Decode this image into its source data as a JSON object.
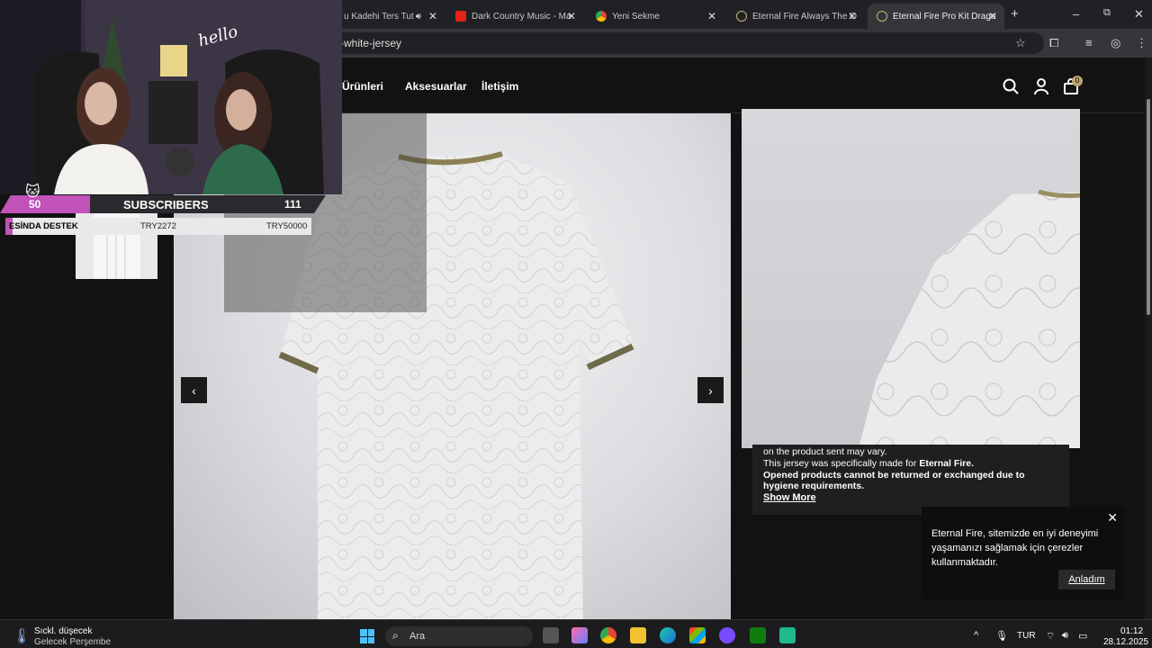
{
  "browser": {
    "tabs": [
      {
        "label": "u Kadehi Ters Tut",
        "icon": "audio-icon"
      },
      {
        "label": "Dark Country Music - Ma",
        "icon": "youtube-icon"
      },
      {
        "label": "Yeni Sekme",
        "icon": "chrome-icon"
      },
      {
        "label": "Eternal Fire Always The O",
        "icon": "eternal-fire-icon"
      },
      {
        "label": "Eternal Fire Pro Kit Drago",
        "icon": "eternal-fire-icon",
        "active": true
      }
    ],
    "new_tab": "+",
    "url": "-white-jersey",
    "window_controls": {
      "minimize": "–",
      "maximize": "⧉",
      "close": "✕"
    }
  },
  "site": {
    "nav": [
      "r Ürünleri",
      "Aksesuarlar",
      "İletişim"
    ],
    "cart_count": "0"
  },
  "gallery": {
    "prev": "‹",
    "next": "›"
  },
  "description": {
    "line1": "on the product sent may vary.",
    "line2_pre": "This jersey was specifically made for ",
    "line2_bold": "Eternal Fire.",
    "line3": "Opened products cannot be returned or exchanged due to",
    "line4": "hygiene requirements.",
    "show_more": "Show More"
  },
  "cookie": {
    "text": "Eternal Fire, sitemizde en iyi deneyimi yaşamanızı sağlamak için çerezler kullanmaktadır.",
    "button": "Anladım",
    "close": "✕"
  },
  "stream_overlay": {
    "hello": "hello",
    "subs_left": "50",
    "subs_label": "SUBSCRIBERS",
    "subs_right": "111",
    "donation_label": "ESİNDA DESTEK",
    "donation_current": "TRY2272",
    "donation_goal": "TRY50000",
    "accent_color": "#c052b8"
  },
  "taskbar": {
    "weather_title": "Sıckl. düşecek",
    "weather_sub": "Gelecek Perşembe",
    "search_placeholder": "Ara",
    "lang": "TUR",
    "time": "01:12",
    "date": "28.12.2025"
  }
}
